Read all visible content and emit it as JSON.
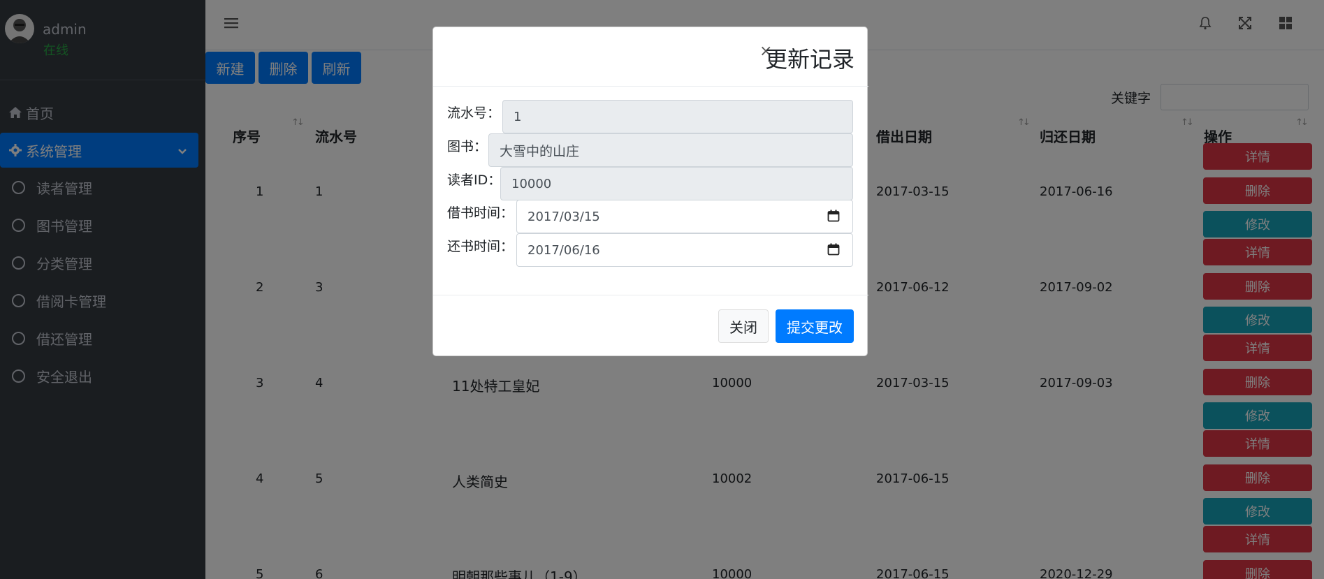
{
  "user": {
    "name": "admin",
    "status": "在线"
  },
  "nav": {
    "home": "首页",
    "system": "系统管理",
    "sub_items": [
      "读者管理",
      "图书管理",
      "分类管理",
      "借阅卡管理",
      "借还管理",
      "安全退出"
    ]
  },
  "toolbar": {
    "new_label": "新建",
    "delete_label": "删除",
    "refresh_label": "刷新"
  },
  "search": {
    "label": "关键字",
    "value": ""
  },
  "table": {
    "columns": [
      "序号",
      "流水号",
      "",
      "",
      "借出日期",
      "归还日期",
      "操作"
    ],
    "rows": [
      {
        "idx": "1",
        "serial": "1",
        "book": "",
        "reader": "",
        "out": "2017-03-15",
        "back": "2017-06-16"
      },
      {
        "idx": "2",
        "serial": "3",
        "book": "",
        "reader": "",
        "out": "2017-06-12",
        "back": "2017-09-02"
      },
      {
        "idx": "3",
        "serial": "4",
        "book": "11处特工皇妃",
        "reader": "10000",
        "out": "2017-03-15",
        "back": "2017-09-03"
      },
      {
        "idx": "4",
        "serial": "5",
        "book": "人类简史",
        "reader": "10002",
        "out": "2017-06-15",
        "back": ""
      },
      {
        "idx": "5",
        "serial": "6",
        "book": "明朝那些事儿（1-9）",
        "reader": "10000",
        "out": "2017-06-15",
        "back": "2020-12-29"
      }
    ],
    "actions": {
      "detail": "详情",
      "delete": "删除",
      "edit": "修改"
    }
  },
  "modal": {
    "close_symbol": "×",
    "title": "更新记录",
    "fields": {
      "serial_label": "流水号：",
      "serial_value": "1",
      "book_label": "图书：",
      "book_value": "大雪中的山庄",
      "reader_label": "读者ID：",
      "reader_value": "10000",
      "borrow_label": "借书时间：",
      "borrow_value": "2017/03/15",
      "return_label": "还书时间：",
      "return_value": "2017/06/16"
    },
    "close_button": "关闭",
    "submit_button": "提交更改"
  },
  "colors": {
    "primary": "#007bff",
    "danger": "#dc3545",
    "info": "#17a2b8",
    "sidebar": "#343a40",
    "online": "#28a745"
  }
}
